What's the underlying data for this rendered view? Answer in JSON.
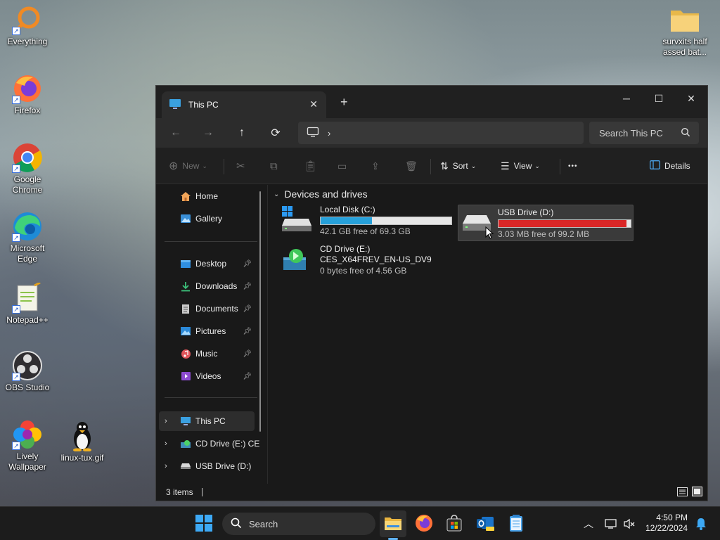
{
  "desktop": {
    "icons": [
      {
        "label": "Everything"
      },
      {
        "label": "Firefox"
      },
      {
        "label": "Google Chrome"
      },
      {
        "label": "Microsoft Edge"
      },
      {
        "label": "Notepad++"
      },
      {
        "label": "OBS Studio"
      },
      {
        "label": "Lively Wallpaper"
      },
      {
        "label": "linux-tux.gif"
      },
      {
        "label": "survxits half assed bat..."
      }
    ]
  },
  "window": {
    "tab_title": "This PC",
    "search_placeholder": "Search This PC",
    "toolbar": {
      "new_label": "New",
      "sort_label": "Sort",
      "view_label": "View",
      "more_label": "•••",
      "details_label": "Details"
    },
    "sidebar": {
      "home": "Home",
      "gallery": "Gallery",
      "desktop": "Desktop",
      "downloads": "Downloads",
      "documents": "Documents",
      "pictures": "Pictures",
      "music": "Music",
      "videos": "Videos",
      "this_pc": "This PC",
      "cd_drive": "CD Drive (E:) CE",
      "usb_drive": "USB Drive (D:)"
    },
    "section_title": "Devices and drives",
    "drives": [
      {
        "name": "Local Disk (C:)",
        "free": "42.1 GB free of 69.3 GB",
        "used_fraction": 0.39,
        "bar_color": "#26a0da"
      },
      {
        "name": "USB Drive (D:)",
        "free": "3.03 MB free of 99.2 MB",
        "used_fraction": 0.97,
        "bar_color": "#da2626"
      },
      {
        "name": "CD Drive (E:)",
        "label": "CES_X64FREV_EN-US_DV9",
        "free": "0 bytes free of 4.56 GB"
      }
    ],
    "status": "3 items"
  },
  "taskbar": {
    "search_label": "Search",
    "time": "4:50 PM",
    "date": "12/22/2024"
  }
}
